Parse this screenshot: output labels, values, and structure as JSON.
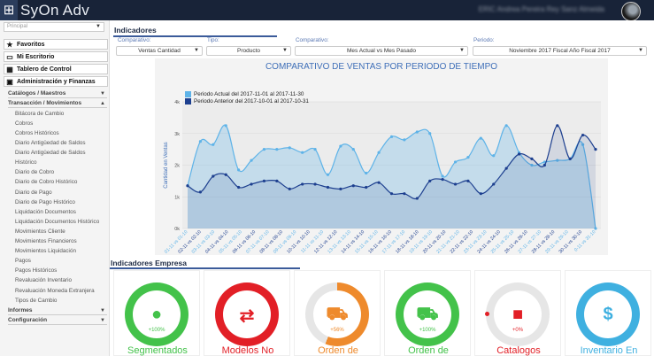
{
  "app": {
    "name": "SyOn Adv",
    "user": "ERIC Andrea Pereira Rey Sanz Almeida"
  },
  "sidebar": {
    "branch_placeholder": "Principal",
    "main": [
      {
        "label": "Favoritos",
        "icon": "star-icon"
      },
      {
        "label": "Mi Escritorio",
        "icon": "monitor-icon"
      },
      {
        "label": "Tablero de Control",
        "icon": "dashboard-icon"
      },
      {
        "label": "Administración y Finanzas",
        "icon": "wallet-icon"
      }
    ],
    "sections": [
      {
        "label": "Catálogos / Maestros"
      },
      {
        "label": "Transacción / Movimientos"
      }
    ],
    "links": [
      "Bitácora de Cambio",
      "Cobros",
      "Cobros Históricos",
      "Diario Antigüedad de Saldos",
      "Diario Antigüedad de Saldos Histórico",
      "Diario de Cobro",
      "Diario de Cobro Histórico",
      "Diario de Pago",
      "Diario de Pago Histórico",
      "Liquidación Documentos",
      "Liquidación Documentos Histórico",
      "Movimientos Cliente",
      "Movimientos Financieros",
      "Movimientos Liquidación",
      "Pagos",
      "Pagos Históricos",
      "Revaluación Inventario",
      "Revaluación Moneda Extranjera",
      "Tipos de Cambio"
    ],
    "bottom_sections": [
      {
        "label": "Informes"
      },
      {
        "label": "Configuración"
      }
    ]
  },
  "indicadores": {
    "title": "Indicadores",
    "filters": [
      {
        "label": "Comparativo:",
        "value": "Ventas Cantidad"
      },
      {
        "label": "Tipo:",
        "value": "Producto"
      },
      {
        "label": "Comparativo:",
        "value": "Mes Actual vs Mes Pasado"
      },
      {
        "label": "Periodo:",
        "value": "Noviembre 2017 Fiscal Año Fiscal 2017"
      }
    ]
  },
  "chart_data": {
    "type": "area",
    "title": "COMPARATIVO DE VENTAS POR PERIODO DE TIEMPO",
    "ylabel": "Cantidad en Ventas",
    "ylim": [
      0,
      4000
    ],
    "yticks": [
      "0k",
      "1k",
      "2k",
      "3k",
      "4k"
    ],
    "categories": [
      "01-11 vs 01-10",
      "02-11 vs 02-10",
      "03-11 vs 03-10",
      "04-11 vs 04-10",
      "05-11 vs 05-10",
      "06-11 vs 06-10",
      "07-11 vs 07-10",
      "08-11 vs 08-10",
      "09-11 vs 09-10",
      "10-11 vs 10-10",
      "11-11 vs 11-10",
      "12-11 vs 12-10",
      "13-11 vs 13-10",
      "14-11 vs 14-10",
      "15-11 vs 15-10",
      "16-11 vs 16-10",
      "17-11 vs 17-10",
      "18-11 vs 18-10",
      "19-11 vs 19-10",
      "20-11 vs 20-10",
      "21-11 vs 21-10",
      "22-11 vs 22-10",
      "23-11 vs 23-10",
      "24-11 vs 24-10",
      "25-11 vs 25-10",
      "26-11 vs 26-10",
      "27-11 vs 27-10",
      "28-11 vs 28-10",
      "29-11 vs 29-10",
      "30-11 vs 30-10",
      "0-11 vs 31-10"
    ],
    "series": [
      {
        "name": "Periodo Actual del 2017-11-01 al 2017-11-30",
        "color": "#5eb3e8",
        "values": [
          1350,
          2750,
          2650,
          3250,
          1850,
          2150,
          2500,
          2500,
          2550,
          2400,
          2500,
          1700,
          2600,
          2500,
          1750,
          2400,
          2900,
          2800,
          3050,
          3000,
          1650,
          2100,
          2250,
          2850,
          2300,
          3250,
          2400,
          2000,
          2100,
          2150,
          2200,
          2650,
          0
        ]
      },
      {
        "name": "Periodo Anterior del 2017-10-01 al 2017-10-31",
        "color": "#1d3f8f",
        "values": [
          1350,
          1150,
          1650,
          1700,
          1300,
          1400,
          1500,
          1500,
          1250,
          1400,
          1400,
          1300,
          1250,
          1350,
          1300,
          1450,
          1100,
          1100,
          950,
          1500,
          1550,
          1400,
          1500,
          1100,
          1400,
          1900,
          2350,
          2200,
          2000,
          3250,
          2200,
          2950,
          2500
        ]
      }
    ]
  },
  "empresa": {
    "title": "Indicadores Empresa",
    "cards": [
      {
        "label": "Segmentados",
        "pct": "+100%",
        "color": "#43c24a",
        "progress": 1.0,
        "icon": "user-icon",
        "glyph": "●"
      },
      {
        "label": "Modelos No",
        "pct": "",
        "color": "#e21f26",
        "progress": 1.0,
        "icon": "transfer-icon",
        "glyph": "⇄"
      },
      {
        "label": "Orden de",
        "pct": "+56%",
        "color": "#ee8a2c",
        "progress": 0.56,
        "icon": "cart-icon",
        "glyph": "🛒"
      },
      {
        "label": "Orden de",
        "pct": "+100%",
        "color": "#43c24a",
        "progress": 1.0,
        "icon": "cart-icon",
        "glyph": "🛒"
      },
      {
        "label": "Catalogos",
        "pct": "+0%",
        "color": "#e21f26",
        "progress": 0.0,
        "icon": "book-icon",
        "glyph": "■"
      },
      {
        "label": "Inventario En",
        "pct": "",
        "color": "#3fb0e0",
        "progress": 1.0,
        "icon": "dollar-icon",
        "glyph": "$"
      }
    ]
  }
}
